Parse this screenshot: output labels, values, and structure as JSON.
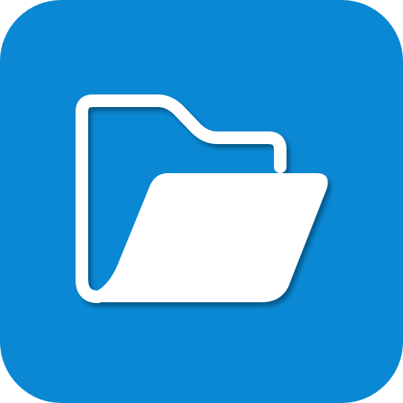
{
  "icon": {
    "name": "folder-open-icon",
    "colors": {
      "tile": "#0A88D4",
      "glyph": "#FFFFFF",
      "shadow": "#000000"
    }
  }
}
